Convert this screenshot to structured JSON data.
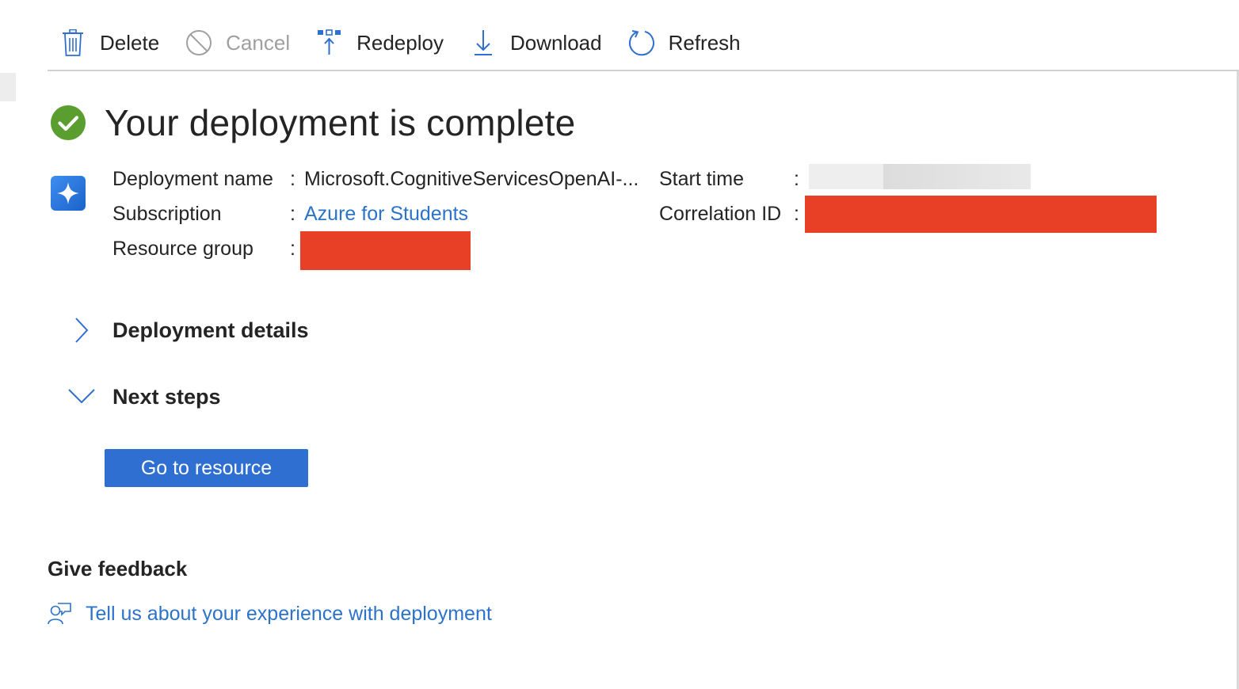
{
  "toolbar": {
    "delete_label": "Delete",
    "cancel_label": "Cancel",
    "redeploy_label": "Redeploy",
    "download_label": "Download",
    "refresh_label": "Refresh"
  },
  "heading": {
    "title": "Your deployment is complete",
    "status_icon": "check-circle-icon"
  },
  "details": {
    "app_icon": "azure-openai-icon",
    "deployment_name_label": "Deployment name",
    "deployment_name_value": "Microsoft.CognitiveServicesOpenAI-...",
    "subscription_label": "Subscription",
    "subscription_value": "Azure for Students",
    "resource_group_label": "Resource group",
    "start_time_label": "Start time",
    "correlation_id_label": "Correlation ID",
    "separator": ":"
  },
  "sections": {
    "deployment_details_label": "Deployment details",
    "next_steps_label": "Next steps",
    "go_to_resource_label": "Go to resource"
  },
  "feedback": {
    "title": "Give feedback",
    "link": "Tell us about your experience with deployment",
    "icon": "person-feedback-icon"
  },
  "colors": {
    "accent": "#2f6fd1",
    "link": "#2b73c9",
    "success": "#5a9e2f",
    "redaction": "#e84027"
  }
}
